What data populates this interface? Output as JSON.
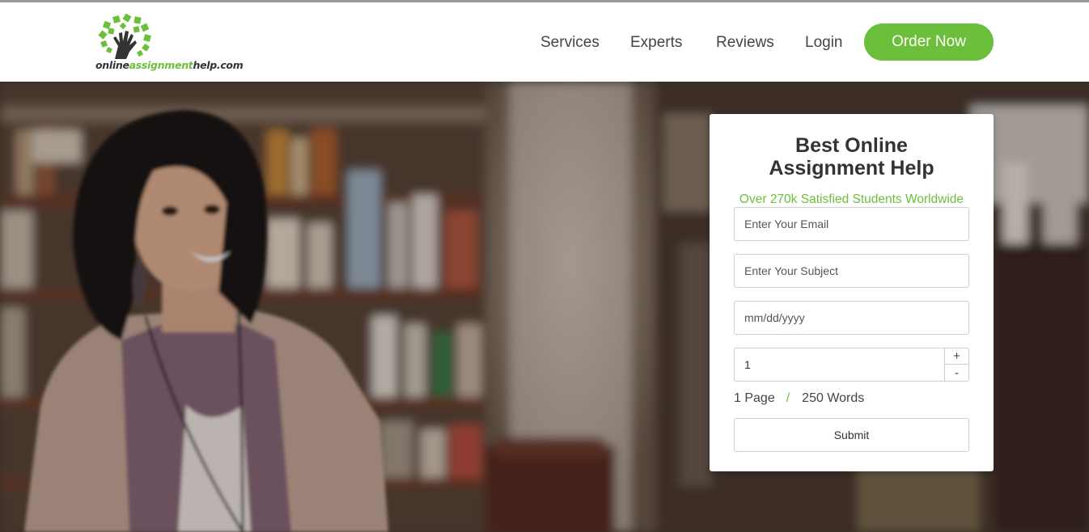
{
  "brand": {
    "logo_text_part1": "online",
    "logo_text_part2": "assignment",
    "logo_text_part3": "help.com",
    "icon": "tree-hand-logo-icon"
  },
  "nav": {
    "items": [
      {
        "label": "Services"
      },
      {
        "label": "Experts"
      },
      {
        "label": "Reviews"
      },
      {
        "label": "Login"
      }
    ],
    "cta_label": "Order Now"
  },
  "form": {
    "title_line1": "Best Online",
    "title_line2": "Assignment Help",
    "subtitle": "Over 270k Satisfied Students Worldwide",
    "email_placeholder": "Enter Your Email",
    "subject_placeholder": "Enter Your Subject",
    "date_placeholder": "mm/dd/yyyy",
    "pages_value": "1",
    "plus_label": "+",
    "minus_label": "-",
    "pages_text": "1 Page",
    "separator": "/",
    "words_text": "250 Words",
    "submit_label": "Submit"
  },
  "colors": {
    "accent": "#6bbf3a",
    "text": "#333333"
  }
}
